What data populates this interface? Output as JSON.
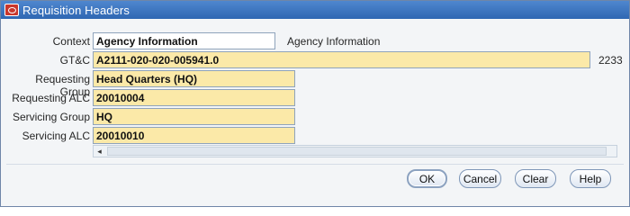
{
  "window": {
    "title": "Requisition Headers"
  },
  "form": {
    "context": {
      "label": "Context",
      "value": "Agency Information",
      "description": "Agency Information"
    },
    "gtc": {
      "label": "GT&C",
      "value": "A2111-020-020-005941.0",
      "overflow_text": "2233"
    },
    "requesting_group": {
      "label": "Requesting Group",
      "value": "Head Quarters (HQ)"
    },
    "requesting_alc": {
      "label": "Requesting ALC",
      "value": "20010004"
    },
    "servicing_group": {
      "label": "Servicing Group",
      "value": "HQ"
    },
    "servicing_alc": {
      "label": "Servicing ALC",
      "value": "20010010"
    }
  },
  "buttons": {
    "ok": "OK",
    "cancel": "Cancel",
    "clear": "Clear",
    "help": "Help"
  },
  "icons": {
    "app": "oracle-icon",
    "scroll_left": "scroll-left-arrow-icon"
  }
}
